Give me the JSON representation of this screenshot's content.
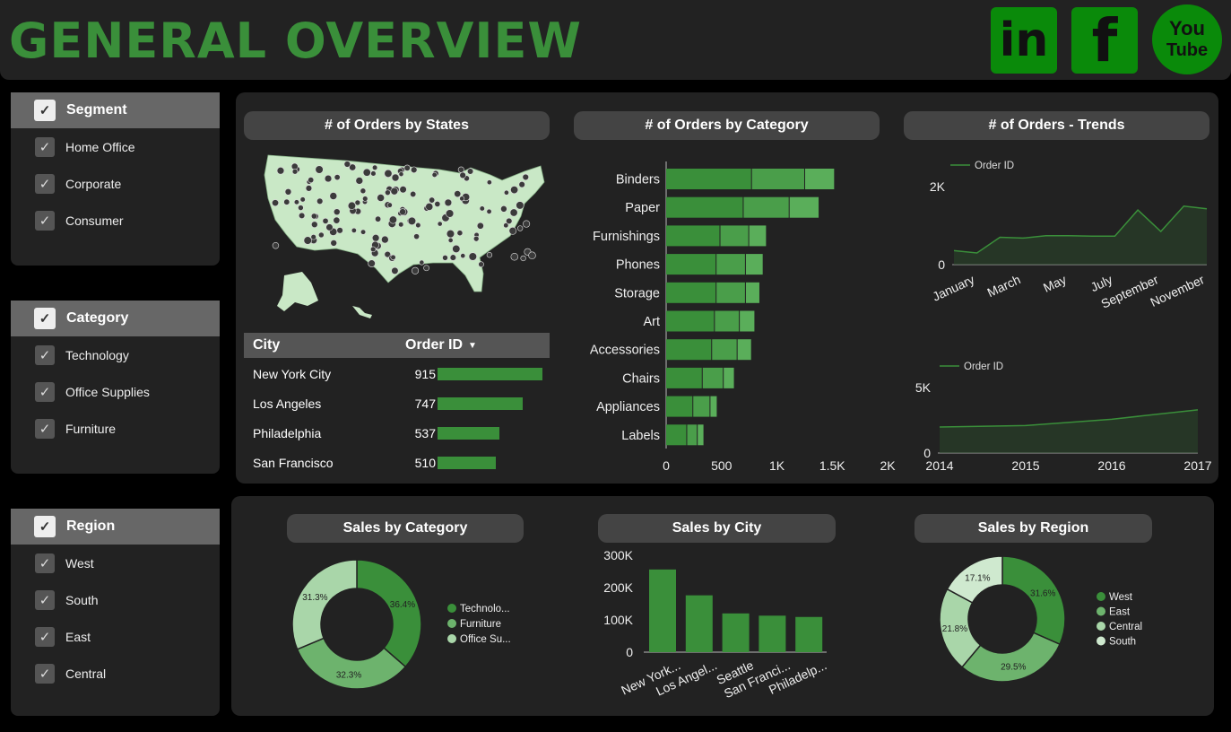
{
  "header": {
    "title": "GENERAL OVERVIEW"
  },
  "social": {
    "linkedin": "in",
    "facebook": "f",
    "youtube_top": "You",
    "youtube_bottom": "Tube"
  },
  "filters": {
    "segment": {
      "label": "Segment",
      "items": [
        "Home Office",
        "Corporate",
        "Consumer"
      ]
    },
    "category": {
      "label": "Category",
      "items": [
        "Technology",
        "Office Supplies",
        "Furniture"
      ]
    },
    "region": {
      "label": "Region",
      "items": [
        "West",
        "South",
        "East",
        "Central"
      ]
    }
  },
  "states_panel": {
    "title": "# of Orders by States",
    "table": {
      "col_city": "City",
      "col_orders": "Order ID",
      "rows": [
        {
          "city": "New York City",
          "value": "915",
          "fraction": 1.0
        },
        {
          "city": "Los Angeles",
          "value": "747",
          "fraction": 0.816
        },
        {
          "city": "Philadelphia",
          "value": "537",
          "fraction": 0.587
        },
        {
          "city": "San Francisco",
          "value": "510",
          "fraction": 0.557
        }
      ]
    }
  },
  "category_panel": {
    "title": "# of Orders by Category"
  },
  "trend_panel": {
    "title": "# of Orders - Trends"
  },
  "sales_category_panel": {
    "title": "Sales by Category"
  },
  "sales_city_panel": {
    "title": "Sales by City"
  },
  "sales_region_panel": {
    "title": "Sales by Region"
  },
  "colors": {
    "green_dark": "#3a8f3a",
    "green_mid": "#6db36d",
    "green_light": "#a9d6a9",
    "bg": "#222222"
  },
  "chart_data": [
    {
      "type": "bar",
      "orientation": "horizontal",
      "stacked": true,
      "categories": [
        "Binders",
        "Paper",
        "Furnishings",
        "Phones",
        "Storage",
        "Art",
        "Accessories",
        "Chairs",
        "Appliances",
        "Labels"
      ],
      "series": [
        {
          "values": [
            775,
            700,
            490,
            455,
            455,
            440,
            415,
            330,
            245,
            190
          ]
        },
        {
          "values": [
            480,
            415,
            260,
            265,
            265,
            225,
            230,
            190,
            155,
            95
          ]
        },
        {
          "values": [
            270,
            270,
            160,
            160,
            130,
            140,
            130,
            100,
            65,
            60
          ]
        }
      ],
      "xticks": [
        "0",
        "500",
        "1K",
        "1.5K",
        "2K"
      ],
      "xlim": [
        0,
        2000
      ]
    },
    {
      "type": "area",
      "legend": "Order ID",
      "x": [
        "January",
        "February",
        "March",
        "April",
        "May",
        "June",
        "July",
        "August",
        "September",
        "October",
        "November",
        "December"
      ],
      "xticks": [
        "January",
        "March",
        "May",
        "July",
        "September",
        "November"
      ],
      "values": [
        360,
        300,
        700,
        680,
        740,
        740,
        730,
        730,
        1400,
        850,
        1500,
        1430
      ],
      "yticks": [
        "0",
        "2K"
      ],
      "ylim": [
        0,
        2000
      ]
    },
    {
      "type": "area",
      "legend": "Order ID",
      "x": [
        "2014",
        "2015",
        "2016",
        "2017"
      ],
      "values": [
        1990,
        2100,
        2580,
        3300
      ],
      "yticks": [
        "0",
        "5K"
      ],
      "ylim": [
        0,
        5000
      ]
    },
    {
      "type": "pie",
      "donut": true,
      "labels": [
        "Technolo...",
        "Furniture",
        "Office Su..."
      ],
      "values": [
        36.4,
        32.3,
        31.3
      ],
      "value_labels": [
        "36.4%",
        "32.3%",
        "31.3%"
      ]
    },
    {
      "type": "bar",
      "categories": [
        "New York...",
        "Los Angel...",
        "Seattle",
        "San Franci...",
        "Philadelp..."
      ],
      "values": [
        256000,
        176000,
        120000,
        113000,
        109000
      ],
      "yticks": [
        "0",
        "100K",
        "200K",
        "300K"
      ],
      "ylim": [
        0,
        300000
      ]
    },
    {
      "type": "pie",
      "donut": true,
      "labels": [
        "West",
        "East",
        "Central",
        "South"
      ],
      "values": [
        31.6,
        29.5,
        21.8,
        17.1
      ],
      "value_labels": [
        "31.6%",
        "29.5%",
        "21.8%",
        "17.1%"
      ]
    }
  ]
}
